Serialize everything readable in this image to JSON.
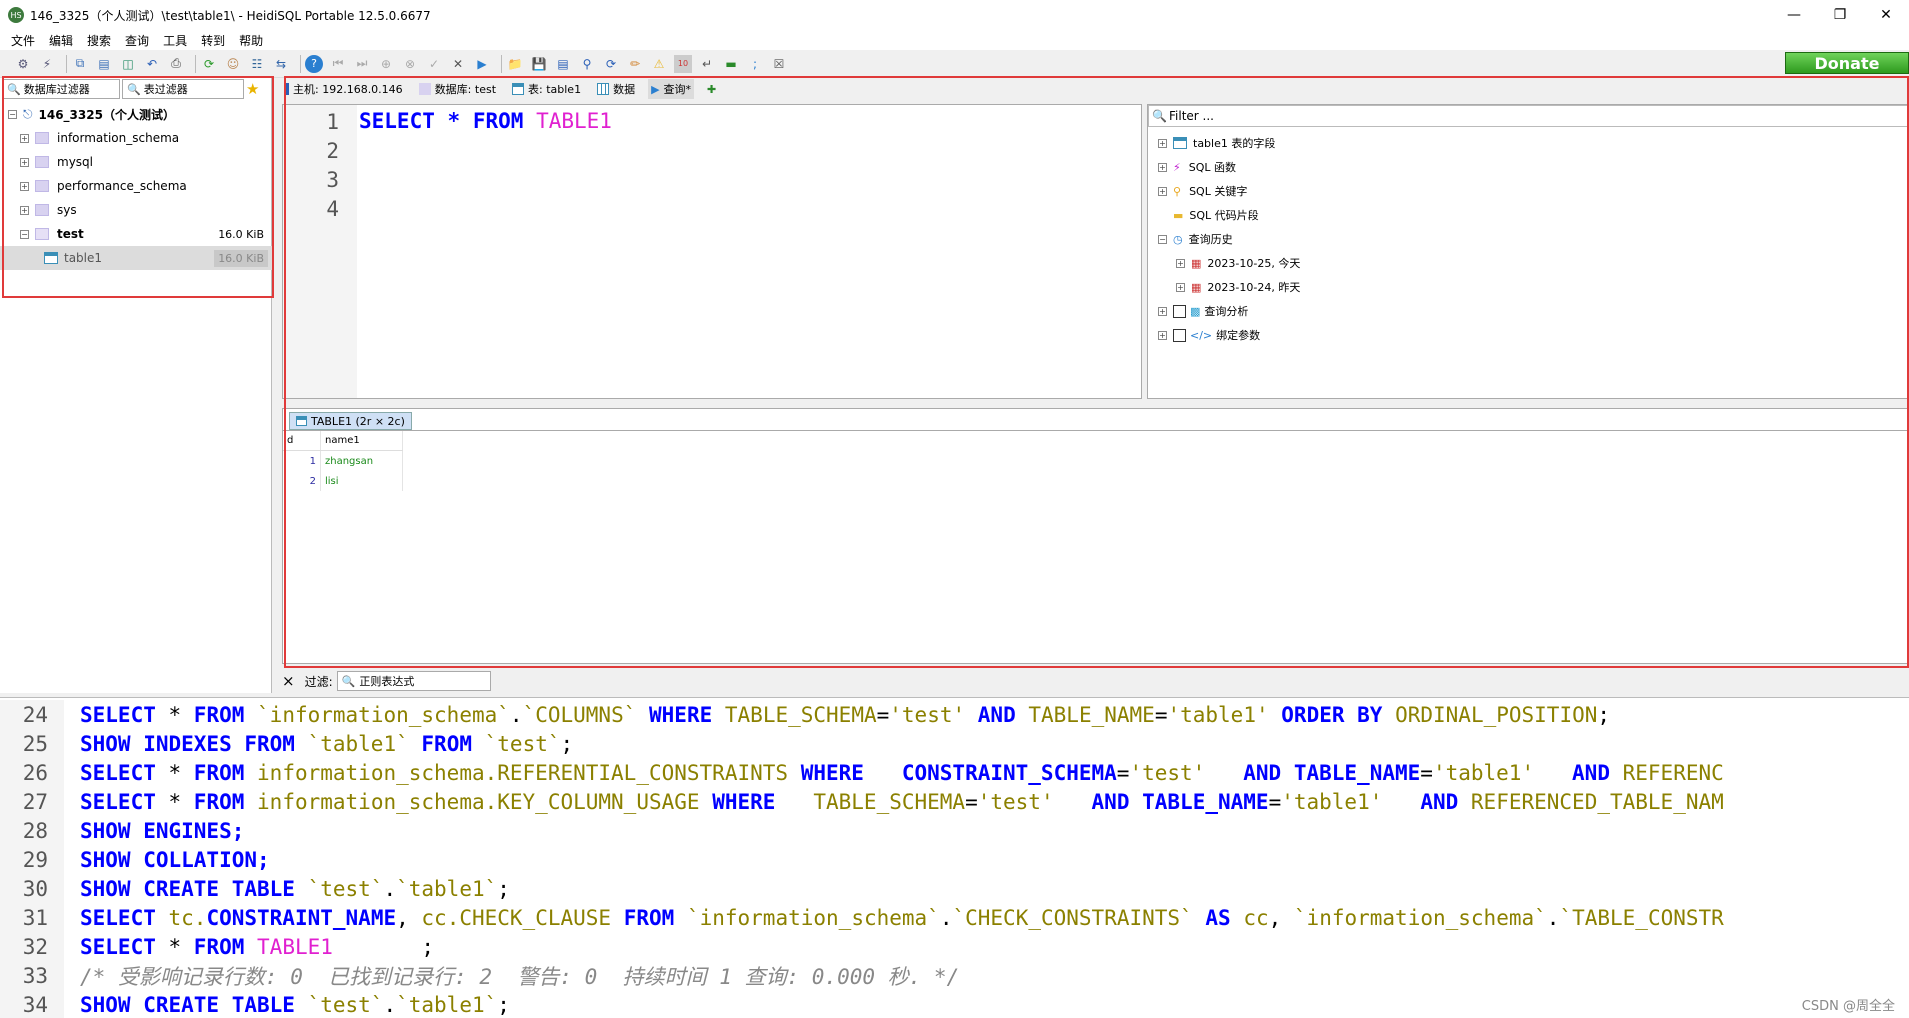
{
  "window": {
    "title": "146_3325（个人测试）\\test\\table1\\ - HeidiSQL Portable 12.5.0.6677",
    "app_icon": "HS"
  },
  "menu": [
    "文件",
    "编辑",
    "搜索",
    "查询",
    "工具",
    "转到",
    "帮助"
  ],
  "donate": "Donate",
  "left": {
    "db_filter": "数据库过滤器",
    "table_filter": "表过滤器",
    "tree": [
      {
        "label": "146_3325（个人测试）",
        "bold": true
      },
      {
        "label": "information_schema"
      },
      {
        "label": "mysql"
      },
      {
        "label": "performance_schema"
      },
      {
        "label": "sys"
      },
      {
        "label": "test",
        "size": "16.0 KiB"
      },
      {
        "label": "table1",
        "size": "16.0 KiB"
      }
    ]
  },
  "tabs": {
    "host": "主机: 192.168.0.146",
    "database": "数据库: test",
    "table": "表: table1",
    "data": "数据",
    "query": "查询*"
  },
  "editor": {
    "line_numbers": [
      "1",
      "2",
      "3",
      "4"
    ],
    "kw1": "SELECT",
    "star": "*",
    "kw2": "FROM",
    "table": "TABLE1"
  },
  "helper": {
    "filter_placeholder": "Filter ...",
    "items": [
      "table1 表的字段",
      "SQL 函数",
      "SQL 关键字",
      "SQL 代码片段",
      "查询历史",
      "2023-10-25, 今天",
      "2023-10-24, 昨天",
      "查询分析",
      "绑定参数"
    ]
  },
  "result": {
    "tab": "TABLE1 (2r × 2c)",
    "columns": [
      "d",
      "name1"
    ],
    "rows": [
      [
        "1",
        "zhangsan"
      ],
      [
        "2",
        "lisi"
      ]
    ]
  },
  "filterbar": {
    "close": "×",
    "label": "过滤:",
    "value": "正则表达式"
  },
  "log": [
    {
      "n": "24",
      "parts": [
        [
          "k",
          "SELECT"
        ],
        [
          "p",
          " * "
        ],
        [
          "k",
          "FROM"
        ],
        [
          "p",
          " "
        ],
        [
          "s",
          "`information_schema`"
        ],
        [
          "p",
          "."
        ],
        [
          "s",
          "`COLUMNS`"
        ],
        [
          "p",
          " "
        ],
        [
          "k",
          "WHERE"
        ],
        [
          "p",
          " "
        ],
        [
          "f",
          "TABLE_SCHEMA"
        ],
        [
          "p",
          "="
        ],
        [
          "s",
          "'test'"
        ],
        [
          "p",
          " "
        ],
        [
          "k",
          "AND"
        ],
        [
          "p",
          " "
        ],
        [
          "f",
          "TABLE_NAME"
        ],
        [
          "p",
          "="
        ],
        [
          "s",
          "'table1'"
        ],
        [
          "p",
          " "
        ],
        [
          "k",
          "ORDER BY"
        ],
        [
          "p",
          " "
        ],
        [
          "f",
          "ORDINAL_POSITION"
        ],
        [
          "p",
          ";"
        ]
      ]
    },
    {
      "n": "25",
      "parts": [
        [
          "k",
          "SHOW INDEXES FROM"
        ],
        [
          "p",
          " "
        ],
        [
          "s",
          "`table1`"
        ],
        [
          "p",
          " "
        ],
        [
          "k",
          "FROM"
        ],
        [
          "p",
          " "
        ],
        [
          "s",
          "`test`"
        ],
        [
          "p",
          ";"
        ]
      ]
    },
    {
      "n": "26",
      "parts": [
        [
          "k",
          "SELECT"
        ],
        [
          "p",
          " * "
        ],
        [
          "k",
          "FROM"
        ],
        [
          "p",
          " "
        ],
        [
          "f",
          "information_schema.REFERENTIAL_CONSTRAINTS"
        ],
        [
          "p",
          " "
        ],
        [
          "k",
          "WHERE"
        ],
        [
          "p",
          "   "
        ],
        [
          "k",
          "CONSTRAINT_SCHEMA"
        ],
        [
          "p",
          "="
        ],
        [
          "s",
          "'test'"
        ],
        [
          "p",
          "   "
        ],
        [
          "k",
          "AND"
        ],
        [
          "p",
          " "
        ],
        [
          "k",
          "TABLE_NAME"
        ],
        [
          "p",
          "="
        ],
        [
          "s",
          "'table1'"
        ],
        [
          "p",
          "   "
        ],
        [
          "k",
          "AND"
        ],
        [
          "p",
          " "
        ],
        [
          "f",
          "REFERENC"
        ]
      ]
    },
    {
      "n": "27",
      "parts": [
        [
          "k",
          "SELECT"
        ],
        [
          "p",
          " * "
        ],
        [
          "k",
          "FROM"
        ],
        [
          "p",
          " "
        ],
        [
          "f",
          "information_schema.KEY_COLUMN_USAGE"
        ],
        [
          "p",
          " "
        ],
        [
          "k",
          "WHERE"
        ],
        [
          "p",
          "   "
        ],
        [
          "f",
          "TABLE_SCHEMA"
        ],
        [
          "p",
          "="
        ],
        [
          "s",
          "'test'"
        ],
        [
          "p",
          "   "
        ],
        [
          "k",
          "AND"
        ],
        [
          "p",
          " "
        ],
        [
          "k",
          "TABLE_NAME"
        ],
        [
          "p",
          "="
        ],
        [
          "s",
          "'table1'"
        ],
        [
          "p",
          "   "
        ],
        [
          "k",
          "AND"
        ],
        [
          "p",
          " "
        ],
        [
          "f",
          "REFERENCED_TABLE_NAM"
        ]
      ]
    },
    {
      "n": "28",
      "parts": [
        [
          "k",
          "SHOW ENGINES;"
        ]
      ]
    },
    {
      "n": "29",
      "parts": [
        [
          "k",
          "SHOW COLLATION;"
        ]
      ]
    },
    {
      "n": "30",
      "parts": [
        [
          "k",
          "SHOW CREATE TABLE"
        ],
        [
          "p",
          " "
        ],
        [
          "s",
          "`test`"
        ],
        [
          "p",
          "."
        ],
        [
          "s",
          "`table1`"
        ],
        [
          "p",
          ";"
        ]
      ]
    },
    {
      "n": "31",
      "parts": [
        [
          "k",
          "SELECT"
        ],
        [
          "p",
          " "
        ],
        [
          "f",
          "tc."
        ],
        [
          "k",
          "CONSTRAINT_NAME"
        ],
        [
          "p",
          ", "
        ],
        [
          "f",
          "cc.CHECK_CLAUSE"
        ],
        [
          "p",
          " "
        ],
        [
          "k",
          "FROM"
        ],
        [
          "p",
          " "
        ],
        [
          "s",
          "`information_schema`"
        ],
        [
          "p",
          "."
        ],
        [
          "s",
          "`CHECK_CONSTRAINTS`"
        ],
        [
          "p",
          " "
        ],
        [
          "k",
          "AS"
        ],
        [
          "p",
          " "
        ],
        [
          "f",
          "cc"
        ],
        [
          "p",
          ", "
        ],
        [
          "s",
          "`information_schema`"
        ],
        [
          "p",
          "."
        ],
        [
          "s",
          "`TABLE_CONSTR"
        ]
      ]
    },
    {
      "n": "32",
      "parts": [
        [
          "k",
          "SELECT"
        ],
        [
          "p",
          " * "
        ],
        [
          "k",
          "FROM"
        ],
        [
          "p",
          " "
        ],
        [
          "t",
          "TABLE1"
        ],
        [
          "p",
          "       ;"
        ]
      ]
    },
    {
      "n": "33",
      "parts": [
        [
          "c",
          "/* 受影响记录行数: 0  已找到记录行: 2  警告: 0  持续时间 1 查询: 0.000 秒. */"
        ]
      ]
    },
    {
      "n": "34",
      "parts": [
        [
          "k",
          "SHOW CREATE TABLE"
        ],
        [
          "p",
          " "
        ],
        [
          "s",
          "`test`"
        ],
        [
          "p",
          "."
        ],
        [
          "s",
          "`table1`"
        ],
        [
          "p",
          ";"
        ]
      ]
    }
  ],
  "watermark": "CSDN @周全全"
}
